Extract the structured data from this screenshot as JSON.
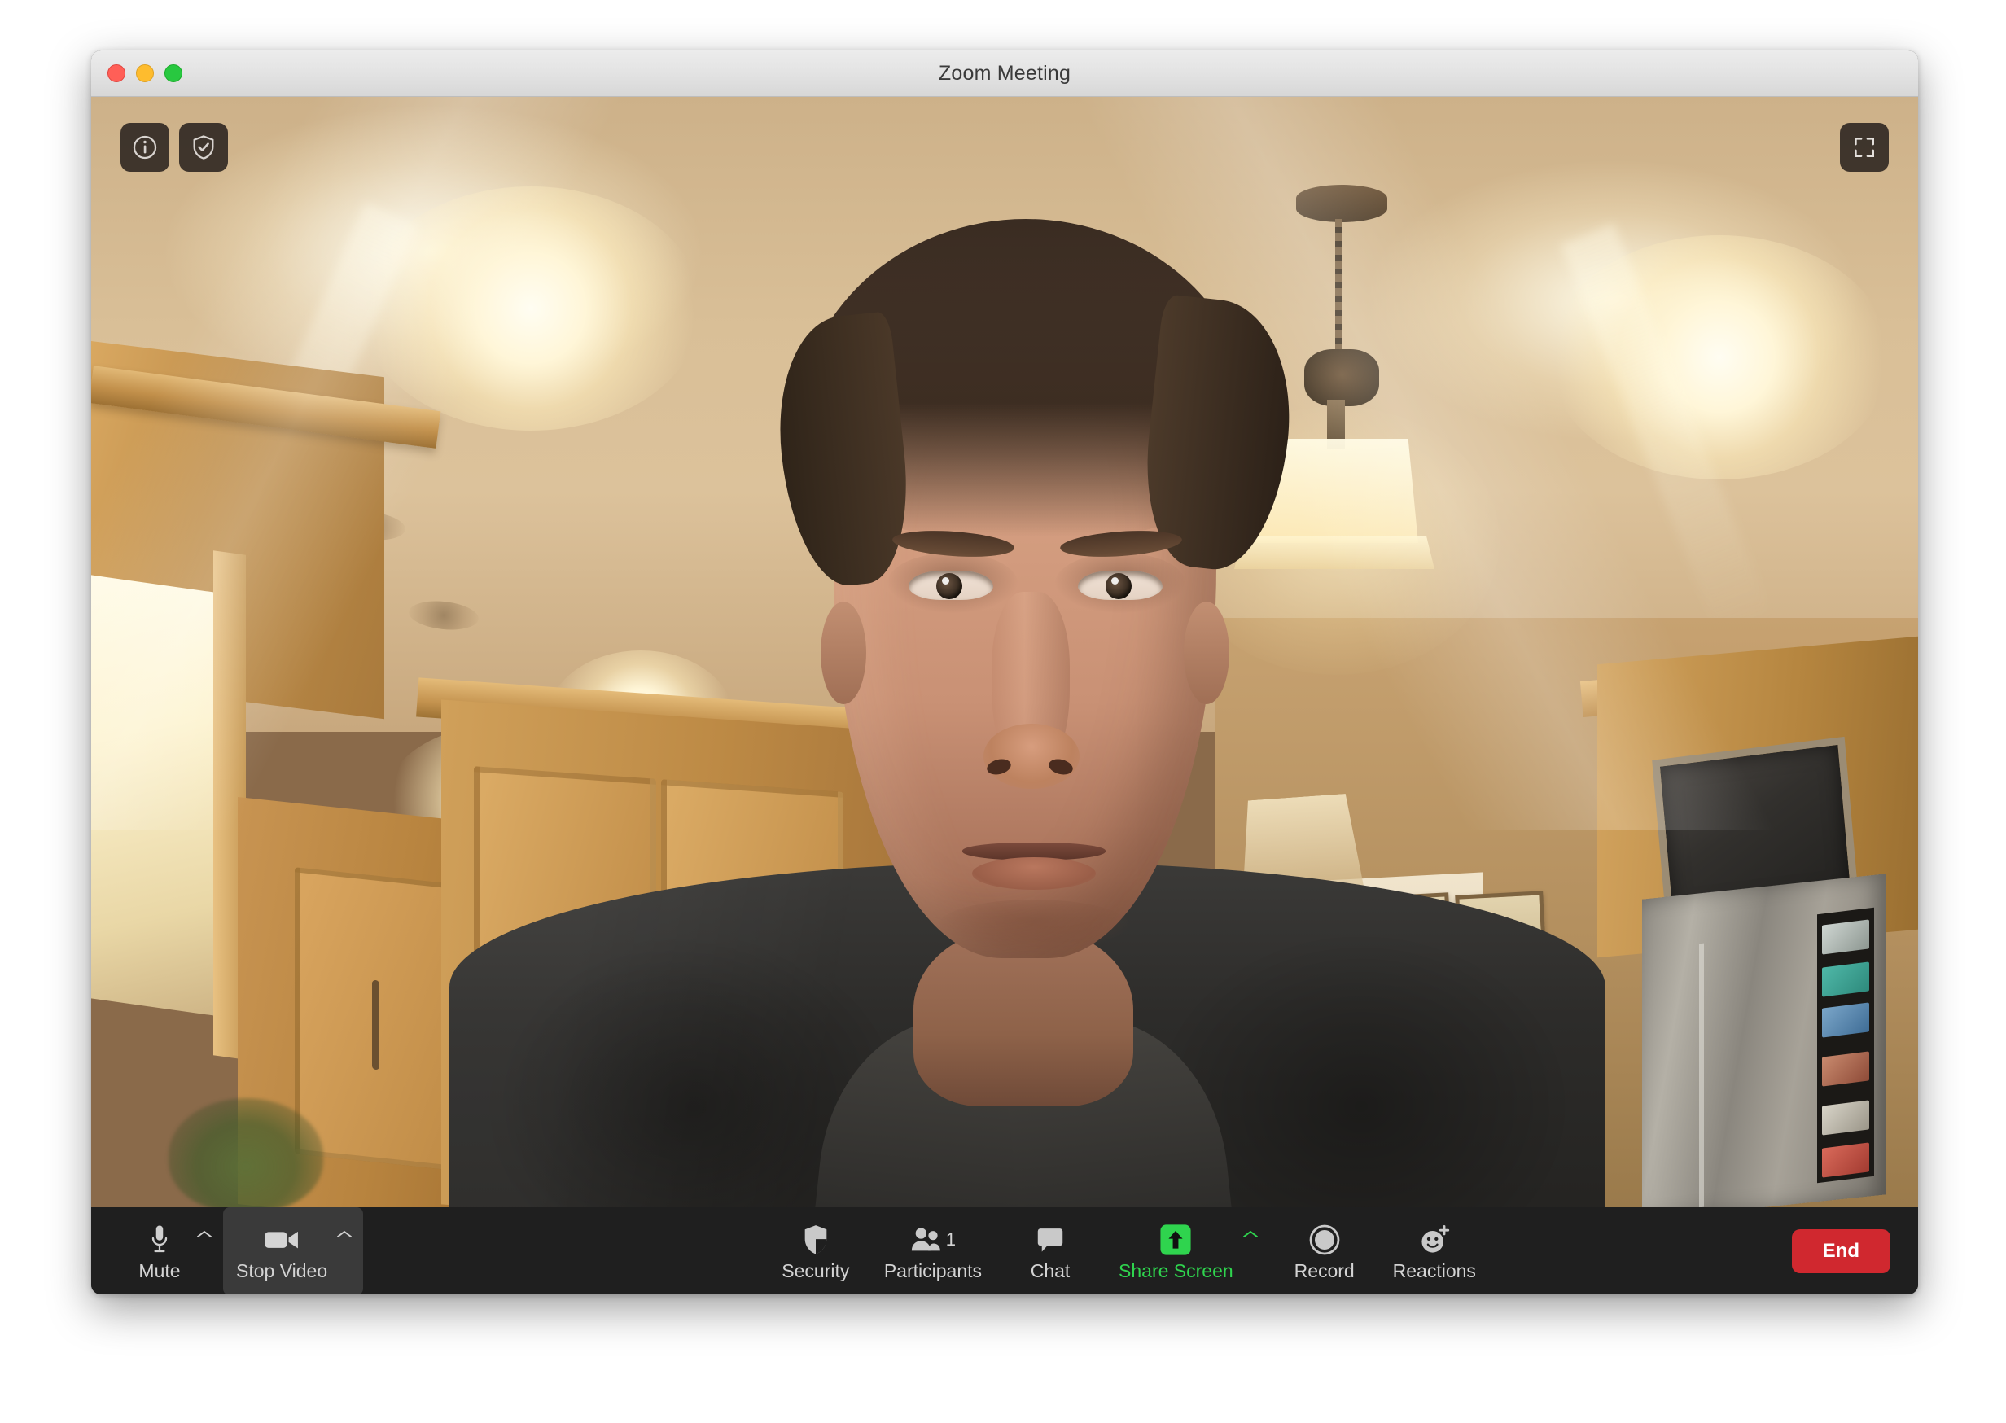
{
  "window": {
    "title": "Zoom Meeting",
    "traffic_lights": {
      "close": "close",
      "minimize": "minimize",
      "maximize": "maximize"
    }
  },
  "video_overlay": {
    "info_icon": "info-icon",
    "security_shield_icon": "shield-check-icon",
    "fullscreen_icon": "fullscreen-icon"
  },
  "toolbar": {
    "left": [
      {
        "id": "mute",
        "label": "Mute",
        "icon": "microphone-icon",
        "caret": true,
        "active": false
      },
      {
        "id": "stop-video",
        "label": "Stop Video",
        "icon": "video-camera-icon",
        "caret": true,
        "active": true
      }
    ],
    "center": [
      {
        "id": "security",
        "label": "Security",
        "icon": "shield-icon",
        "caret": false,
        "accent": "default",
        "count": ""
      },
      {
        "id": "participants",
        "label": "Participants",
        "icon": "people-icon",
        "caret": false,
        "accent": "default",
        "count": "1"
      },
      {
        "id": "chat",
        "label": "Chat",
        "icon": "chat-bubble-icon",
        "caret": false,
        "accent": "default",
        "count": ""
      },
      {
        "id": "share-screen",
        "label": "Share Screen",
        "icon": "share-screen-icon",
        "caret": true,
        "accent": "green",
        "count": ""
      },
      {
        "id": "record",
        "label": "Record",
        "icon": "record-icon",
        "caret": false,
        "accent": "default",
        "count": ""
      },
      {
        "id": "reactions",
        "label": "Reactions",
        "icon": "reactions-icon",
        "caret": false,
        "accent": "default",
        "count": ""
      }
    ],
    "end_label": "End"
  },
  "colors": {
    "toolbar_bg": "#1f1f1f",
    "toolbar_active_bg": "#3a3a3a",
    "label": "#d3d3d3",
    "accent_green": "#2fd44e",
    "end_red": "#d0282f",
    "titlebar_bg": "#e3e3e3"
  },
  "scene": {
    "description": "Webcam self-view of a man in a dark jacket in a warmly lit kitchen",
    "elements": [
      "ceiling",
      "pendant-lamp",
      "wood-cabinets",
      "window",
      "refrigerator",
      "wall-mounted-tv",
      "fruit-paintings",
      "houseplant"
    ]
  }
}
